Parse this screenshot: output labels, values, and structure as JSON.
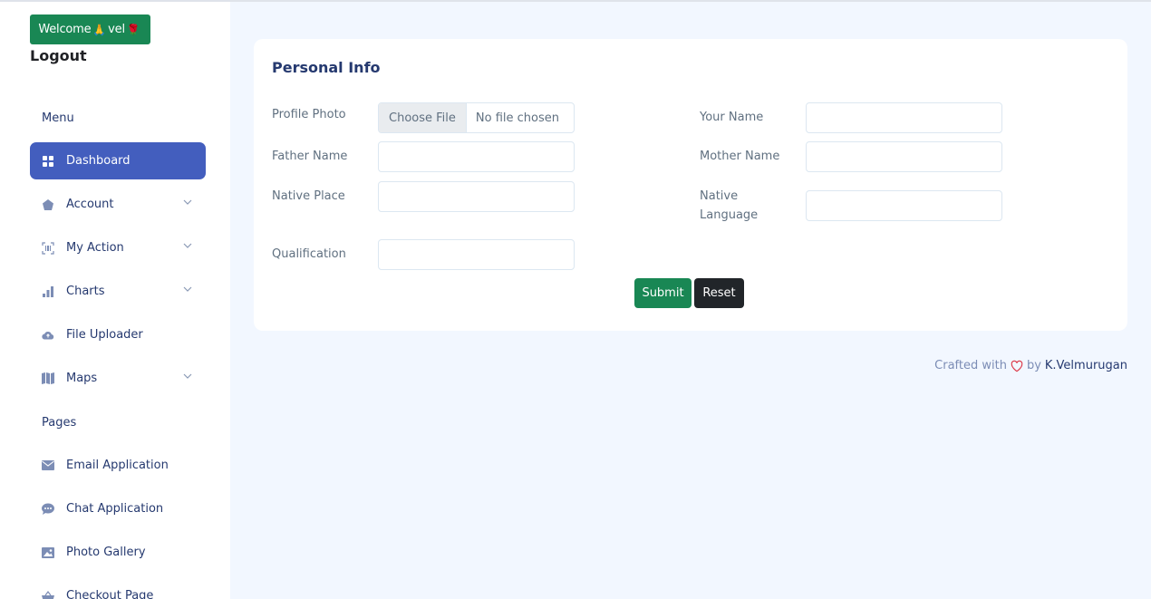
{
  "sidebar": {
    "welcome_text": "Welcome",
    "welcome_user": "vel",
    "welcome_emoji_left": "🙏",
    "welcome_emoji_right": "🌹",
    "logout": "Logout",
    "menu_title": "Menu",
    "pages_title": "Pages",
    "menu_items": [
      {
        "label": "Dashboard",
        "icon": "grid-icon",
        "active": true
      },
      {
        "label": "Account",
        "icon": "pentagon-icon",
        "dropdown": true
      },
      {
        "label": "My Action",
        "icon": "barcode-icon",
        "dropdown": true
      },
      {
        "label": "Charts",
        "icon": "bar-chart-icon",
        "dropdown": true
      },
      {
        "label": "File Uploader",
        "icon": "cloud-upload-icon"
      },
      {
        "label": "Maps",
        "icon": "map-icon",
        "dropdown": true
      }
    ],
    "page_items": [
      {
        "label": "Email Application",
        "icon": "envelope-icon"
      },
      {
        "label": "Chat Application",
        "icon": "chat-icon"
      },
      {
        "label": "Photo Gallery",
        "icon": "image-icon"
      },
      {
        "label": "Checkout Page",
        "icon": "basket-icon"
      }
    ]
  },
  "form": {
    "title": "Personal Info",
    "profile_photo_label": "Profile Photo",
    "choose_file": "Choose File",
    "no_file": "No file chosen",
    "your_name_label": "Your Name",
    "your_name_value": "",
    "father_name_label": "Father Name",
    "father_name_value": "",
    "mother_name_label": "Mother Name",
    "mother_name_value": "",
    "native_place_label": "Native Place",
    "native_place_value": "",
    "native_language_label_line1": "Native",
    "native_language_label_line2": "Language",
    "native_language_value": "",
    "qualification_label": "Qualification",
    "qualification_value": "",
    "submit": "Submit",
    "reset": "Reset"
  },
  "footer": {
    "crafted": "Crafted with",
    "by": "by",
    "author": "K.Velmurugan"
  },
  "colors": {
    "primary": "#435ebe",
    "success": "#198754",
    "dark": "#212529",
    "heart": "#dc3545"
  }
}
